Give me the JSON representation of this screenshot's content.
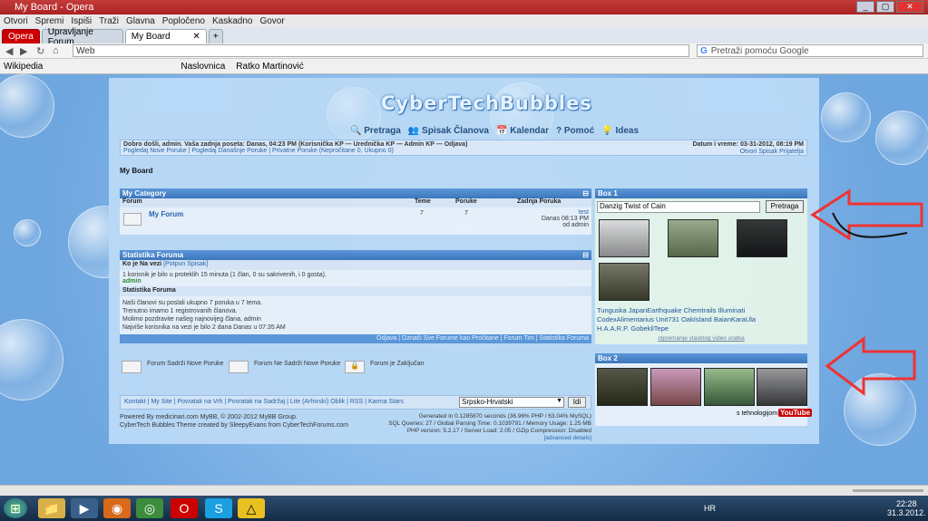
{
  "window": {
    "title": "My Board - Opera"
  },
  "menu": [
    "Otvori",
    "Spremi",
    "Ispiši",
    "Traži",
    "Glavna",
    "Popločeno",
    "Kaskadno",
    "Govor"
  ],
  "tabs": [
    {
      "label": "Opera"
    },
    {
      "label": "Upravljanje Forum..."
    },
    {
      "label": "My Board"
    }
  ],
  "address": {
    "mode": "Web",
    "search_placeholder": "Pretraži pomoću Google"
  },
  "bookmarks": [
    "Wikipedia",
    "Naslovnica",
    "Ratko Martinović"
  ],
  "site": {
    "logo": "CyberTechBubbles",
    "toplinks": [
      "Pretraga",
      "Spisak Članova",
      "Kalendar",
      "Pomoć",
      "Ideas"
    ],
    "welcome_line1": "Dobro došli, admin. Vaša zadnja poseta: Danas, 04:23 PM (Korisnička KP — Urednička KP — Admin KP — Odjava)",
    "welcome_line2": "Pogledaj Nove Poruke | Pogledaj Današnje Poruke | Privatne Poruke (Nepročitane 0, Ukupno 0)",
    "datetime_label": "Datum i vreme: 03-31-2012, 08:19 PM",
    "online_list": "Otvori Spisak Prijatelja",
    "breadcrumb": "My Board",
    "category": {
      "title": "My Category",
      "headers": [
        "Forum",
        "Teme",
        "Poruke",
        "Zadnja Poruka"
      ],
      "forum_name": "My Forum",
      "threads": "7",
      "posts": "7",
      "last_title": "test",
      "last_time": "Danas 08:13 PM",
      "last_by": "od admin"
    },
    "stats": {
      "title": "Statistika Foruma",
      "who_online": "Ko je Na vezi",
      "full_list": "[Potpun Spisak]",
      "online_text": "1 korisnik je bilo u proteklih 15 minuta (1 član, 0 su sakrivenih, i 0 gosta).",
      "online_user": "admin",
      "stats_head": "Statistika Foruma",
      "s1": "Naši članovi su poslali ukupno 7 poruka u 7 tema.",
      "s2": "Trenutno imamo 1 registrovanih članova.",
      "s3": "Molimo pozdravite našeg najnovijeg člana, admin",
      "s4": "Najviše korisnika na vezi je bilo 2 dana Danas u 07:35 AM",
      "bottom_links": "Odjava | Označi Sve Forume kao Pročitane | Forum Tim | Statistika Foruma"
    },
    "legend": [
      "Forum Sadrži Nove Poruke",
      "Forum Ne Sadrži Nove Poruke",
      "Forum je Zaključan"
    ],
    "footer_links": "Kontakt | My Site | Povratak na Vrh | Povratak na Sadržaj | Lite (Arhivski) Oblik | RSS | Karma Stars",
    "lang_select": "Srpsko-Hrvatski",
    "go_button": "Idi",
    "powered1": "Powered By medicinari.com MyBB, © 2002-2012 MyBB Group.",
    "powered2": "CyberTech Bubbles Theme created by SleepyEvans from CyberTechForums.com",
    "gen1": "Generated in 0.1285870 seconds (36.96% PHP / 63.04% MySQL)",
    "gen2": "SQL Queries: 27 / Global Parsing Time: 0.1039791 / Memory Usage: 1.25 MB",
    "gen3": "PHP version: 5.2.17 / Server Load: 2.05 / GZip Compression: Disabled",
    "gen4": "[advanced details]",
    "box1": {
      "title": "Box 1",
      "search_value": "Danzig Twist of Cain",
      "search_button": "Pretraga",
      "tags_line1": "Tunguska  JapanEarthquake  Chemtrails  Illuminati",
      "tags_line2": "CodexAlimentarius  Unit731  OakIsland  BaianKaraUla",
      "tags_line3": "H.A.A.R.P.  GobekliTepe",
      "footer": "otpremanje vlastitog video uratka"
    },
    "box2": {
      "title": "Box 2",
      "youtube": "s tehnologijom",
      "yt_logo": "YouTube"
    }
  },
  "taskbar": {
    "language": "HR",
    "time": "22:28",
    "date": "31.3.2012."
  }
}
